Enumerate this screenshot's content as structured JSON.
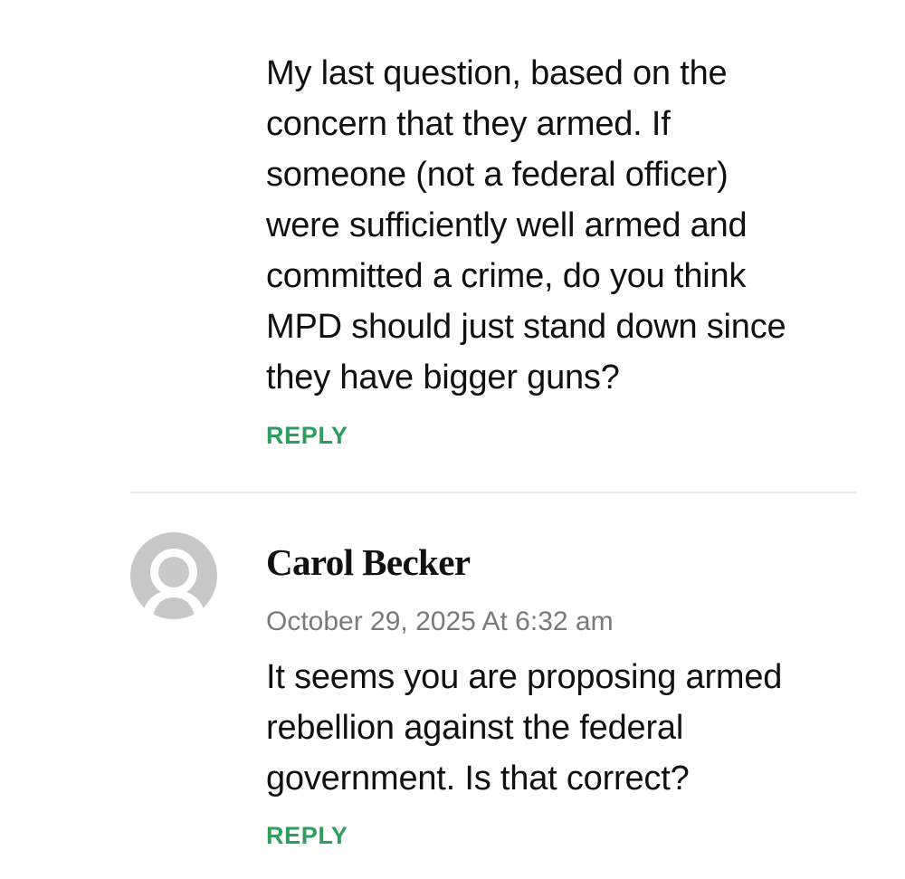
{
  "comments": [
    {
      "body_lines": [
        "My last question, based on the",
        "concern that they armed. If",
        "someone (not a federal officer)",
        "were sufficiently well armed and",
        "committed a crime, do you think",
        "MPD should just stand down since",
        "they have bigger guns?"
      ],
      "reply_label": "REPLY"
    },
    {
      "author": "Carol Becker",
      "avatar_icon": "default-user-avatar-icon",
      "date": "October 29, 2025 At 6:32 am",
      "body_lines": [
        "It seems you are proposing armed",
        "rebellion against the federal",
        "government. Is that correct?"
      ],
      "reply_label": "REPLY"
    }
  ],
  "colors": {
    "reply_link": "#2e9e5e",
    "date_text": "#7a7a7a",
    "avatar_gray": "#c8c8c8",
    "divider": "#e6e6e6"
  }
}
